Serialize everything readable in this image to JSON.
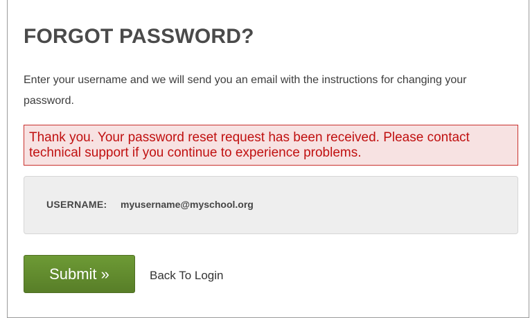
{
  "page": {
    "title": "FORGOT PASSWORD?",
    "intro": "Enter your username and we will send you an email with the instructions for changing your password."
  },
  "alert": {
    "message": "Thank you. Your password reset request has been received. Please contact technical support if you continue to experience problems."
  },
  "form": {
    "username_label": "USERNAME:",
    "username_value": "myusername@myschool.org"
  },
  "actions": {
    "submit_label": "Submit »",
    "back_label": "Back To Login"
  },
  "colors": {
    "submit_button": "#6d9a35",
    "alert_border": "#c9302c",
    "alert_text": "#c01010",
    "field_background": "#eeeeee"
  }
}
